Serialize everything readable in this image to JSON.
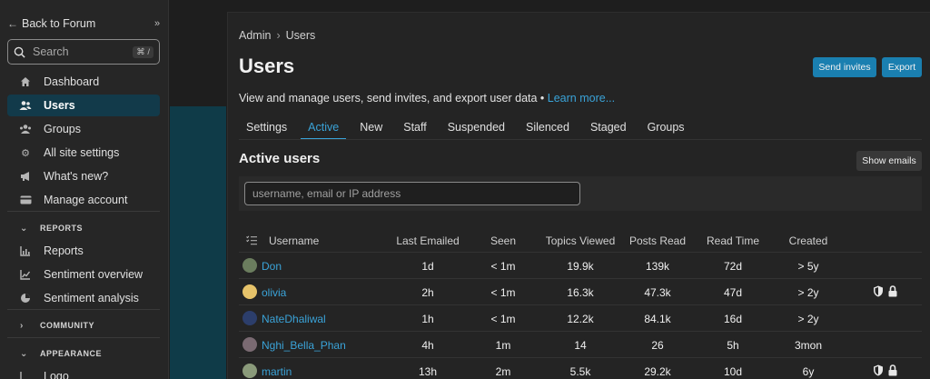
{
  "sidebar": {
    "back_label": "Back to Forum",
    "search_placeholder": "Search",
    "search_shortcut": "⌘ /",
    "items": [
      {
        "label": "Dashboard",
        "icon": "home-icon"
      },
      {
        "label": "Users",
        "icon": "users-icon",
        "active": true
      },
      {
        "label": "Groups",
        "icon": "groups-icon"
      },
      {
        "label": "All site settings",
        "icon": "gear-icon"
      },
      {
        "label": "What's new?",
        "icon": "megaphone-icon"
      },
      {
        "label": "Manage account",
        "icon": "card-icon"
      }
    ],
    "reports_section": "REPORTS",
    "report_items": [
      {
        "label": "Reports",
        "icon": "chart-icon"
      },
      {
        "label": "Sentiment overview",
        "icon": "chart-line-icon"
      },
      {
        "label": "Sentiment analysis",
        "icon": "pie-icon"
      }
    ],
    "community_section": "COMMUNITY",
    "appearance_section": "APPEARANCE",
    "appearance_items": [
      {
        "label": "Logo",
        "icon": "image-icon"
      }
    ]
  },
  "main": {
    "breadcrumb": {
      "root": "Admin",
      "current": "Users"
    },
    "title": "Users",
    "send_invites": "Send invites",
    "export": "Export",
    "description": "View and manage users, send invites, and export user data •",
    "learn_more": "Learn more...",
    "tabs": [
      "Settings",
      "Active",
      "New",
      "Staff",
      "Suspended",
      "Silenced",
      "Staged",
      "Groups"
    ],
    "active_tab": "Active",
    "section_title": "Active users",
    "show_emails": "Show emails",
    "filter_placeholder": "username, email or IP address"
  },
  "table": {
    "headers": [
      "Username",
      "Last Emailed",
      "Seen",
      "Topics Viewed",
      "Posts Read",
      "Read Time",
      "Created"
    ],
    "rows": [
      {
        "username": "Don",
        "last_emailed": "1d",
        "seen": "< 1m",
        "topics_viewed": "19.9k",
        "posts_read": "139k",
        "read_time": "72d",
        "created": "> 5y",
        "staff_badges": false
      },
      {
        "username": "olivia",
        "last_emailed": "2h",
        "seen": "< 1m",
        "topics_viewed": "16.3k",
        "posts_read": "47.3k",
        "read_time": "47d",
        "created": "> 2y",
        "staff_badges": true
      },
      {
        "username": "NateDhaliwal",
        "last_emailed": "1h",
        "seen": "< 1m",
        "topics_viewed": "12.2k",
        "posts_read": "84.1k",
        "read_time": "16d",
        "created": "> 2y",
        "staff_badges": false
      },
      {
        "username": "Nghi_Bella_Phan",
        "last_emailed": "4h",
        "seen": "1m",
        "topics_viewed": "14",
        "posts_read": "26",
        "read_time": "5h",
        "created": "3mon",
        "staff_badges": false
      },
      {
        "username": "martin",
        "last_emailed": "13h",
        "seen": "2m",
        "topics_viewed": "5.5k",
        "posts_read": "29.2k",
        "read_time": "10d",
        "created": "6y",
        "staff_badges": true
      }
    ]
  },
  "colors": {
    "accent": "#3aa3d8",
    "button": "#1a7fb0",
    "active_nav": "#123a4a"
  }
}
